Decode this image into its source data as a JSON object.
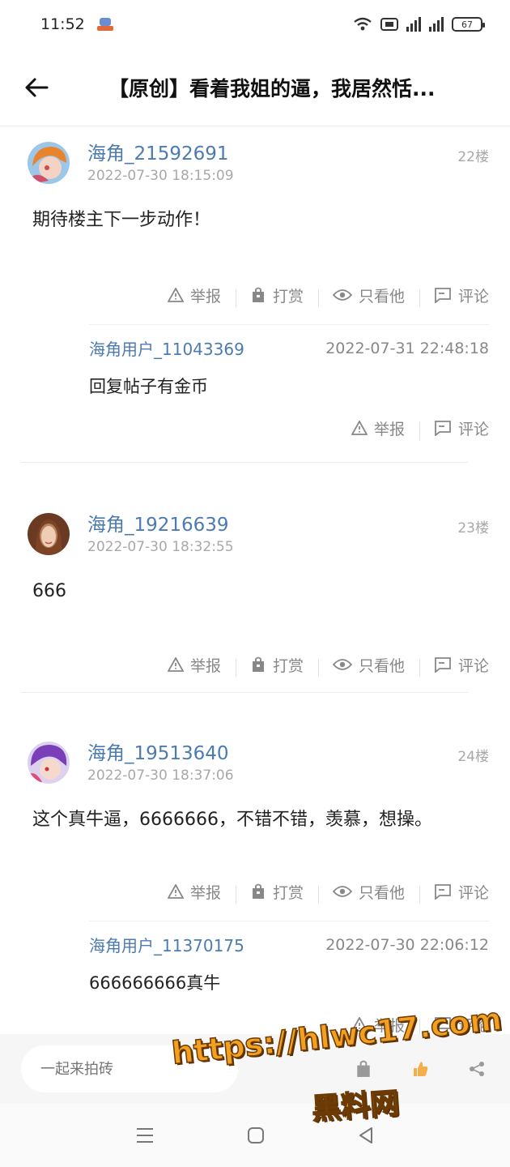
{
  "status_bar": {
    "time": "11:52",
    "battery": "67"
  },
  "header": {
    "title": "【原创】看着我姐的逼，我居然恬..."
  },
  "actions": {
    "report": "举报",
    "tip": "打赏",
    "only_him": "只看他",
    "comment": "评论"
  },
  "posts": [
    {
      "username": "海角_21592691",
      "datetime": "2022-07-30 18:15:09",
      "floor": "22楼",
      "body": "期待楼主下一步动作！",
      "reply": {
        "username": "海角用户_11043369",
        "datetime": "2022-07-31 22:48:18",
        "text": "回复帖子有金币"
      }
    },
    {
      "username": "海角_19216639",
      "datetime": "2022-07-30 18:32:55",
      "floor": "23楼",
      "body": "666"
    },
    {
      "username": "海角_19513640",
      "datetime": "2022-07-30 18:37:06",
      "floor": "24楼",
      "body": "这个真牛逼，6666666，不错不错，羡慕，想操。",
      "reply": {
        "username": "海角用户_11370175",
        "datetime": "2022-07-30 22:06:12",
        "text": "666666666真牛"
      }
    }
  ],
  "bottom_bar": {
    "placeholder": "一起来拍砖"
  },
  "watermark": {
    "line1": "https://hlwc17.com",
    "line2": "黑料网"
  },
  "colors": {
    "username": "#4c7bb0",
    "muted": "#a8a8a8",
    "watermark": "#f3a021"
  }
}
